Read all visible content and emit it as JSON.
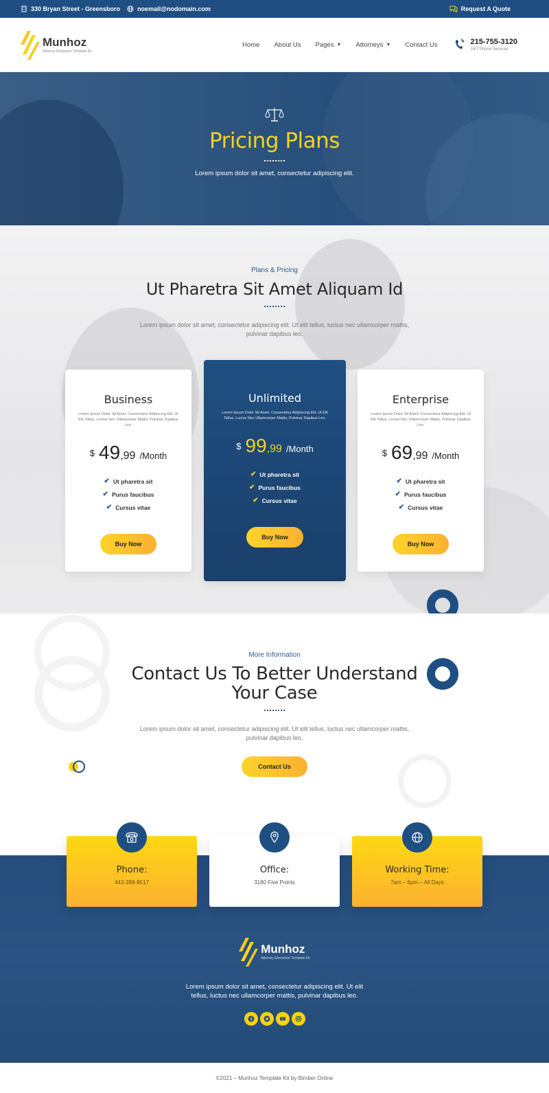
{
  "topbar": {
    "address": "330 Bryan Street - Greensboro",
    "email": "noemail@nodomain.com",
    "quote": "Request A Quote"
  },
  "brand": {
    "name": "Munhoz",
    "tagline": "Attorney Elementor Template Kit"
  },
  "nav": {
    "items": [
      "Home",
      "About Us",
      "Pages",
      "Attorneys",
      "Contact Us"
    ]
  },
  "contact_phone": {
    "number": "215-755-3120",
    "sub": "24/7 Phone Services"
  },
  "hero": {
    "title": "Pricing Plans",
    "text": "Lorem ipsum dolor sit amet, consectetur adipiscing elit."
  },
  "pricing": {
    "eyebrow": "Plans & Pricing",
    "title": "Ut Pharetra Sit Amet Aliquam Id",
    "text": "Lorem ipsum dolor sit amet, consectetur adipiscing elit. Ut elit tellus, luctus nec ullamcorper mattis, pulvinar dapibus leo.",
    "plans": [
      {
        "name": "Business",
        "desc": "Lorem Ipsum Dolor Sit Amet, Consectetur Adipiscing Elit. Ut Elit Tellus, Luctus Nec Ullamcorper Mattis, Pulvinar Dapibus Leo.",
        "currency": "$",
        "int": "49",
        "dec": ",99",
        "per": "/Month",
        "features": [
          "Ut pharetra sit",
          "Purus faucibus",
          "Cursus vitae"
        ],
        "button": "Buy Now"
      },
      {
        "name": "Unlimited",
        "desc": "Lorem Ipsum Dolor Sit Amet, Consectetur Adipiscing Elit. Ut Elit Tellus, Luctus Nec Ullamcorper Mattis, Pulvinar Dapibus Leo.",
        "currency": "$",
        "int": "99",
        "dec": ",99",
        "per": "/Month",
        "features": [
          "Ut pharetra sit",
          "Purus faucibus",
          "Cursus vitae"
        ],
        "button": "Buy Now"
      },
      {
        "name": "Enterprise",
        "desc": "Lorem Ipsum Dolor Sit Amet, Consectetur Adipiscing Elit. Ut Elit Tellus, Luctus Nec Ullamcorper Mattis, Pulvinar Dapibus Leo.",
        "currency": "$",
        "int": "69",
        "dec": ",99",
        "per": "/Month",
        "features": [
          "Ut pharetra sit",
          "Purus faucibus",
          "Cursus vitae"
        ],
        "button": "Buy Now"
      }
    ]
  },
  "contact": {
    "eyebrow": "More Information",
    "title": "Contact Us To Better Understand Your Case",
    "text": "Lorem ipsum dolor sit amet, consectetur adipiscing elit. Ut elit tellus, luctus nec ullamcorper mattis, pulvinar dapibus leo.",
    "button": "Contact Us"
  },
  "info": [
    {
      "label": "Phone:",
      "value": "443-288-9517",
      "icon": "phone-icon"
    },
    {
      "label": "Office:",
      "value": "3180 Five Points",
      "icon": "location-pin-icon"
    },
    {
      "label": "Working Time:",
      "value": "7am – 6pm – All Days",
      "icon": "globe-icon"
    }
  ],
  "footer": {
    "text": "Lorem ipsum dolor sit amet, consectetur adipiscing elit. Ut elit tellus, luctus nec ullamcorper mattis, pulvinar dapibus leo.",
    "social": [
      "facebook-icon",
      "twitter-icon",
      "youtube-icon",
      "instagram-icon"
    ],
    "copyright": "©2021 – Munhoz Template Kit by Bimber Online"
  },
  "colors": {
    "navy": "#1f4f82",
    "yellow": "#f6d31d",
    "button": "#fbb131"
  }
}
